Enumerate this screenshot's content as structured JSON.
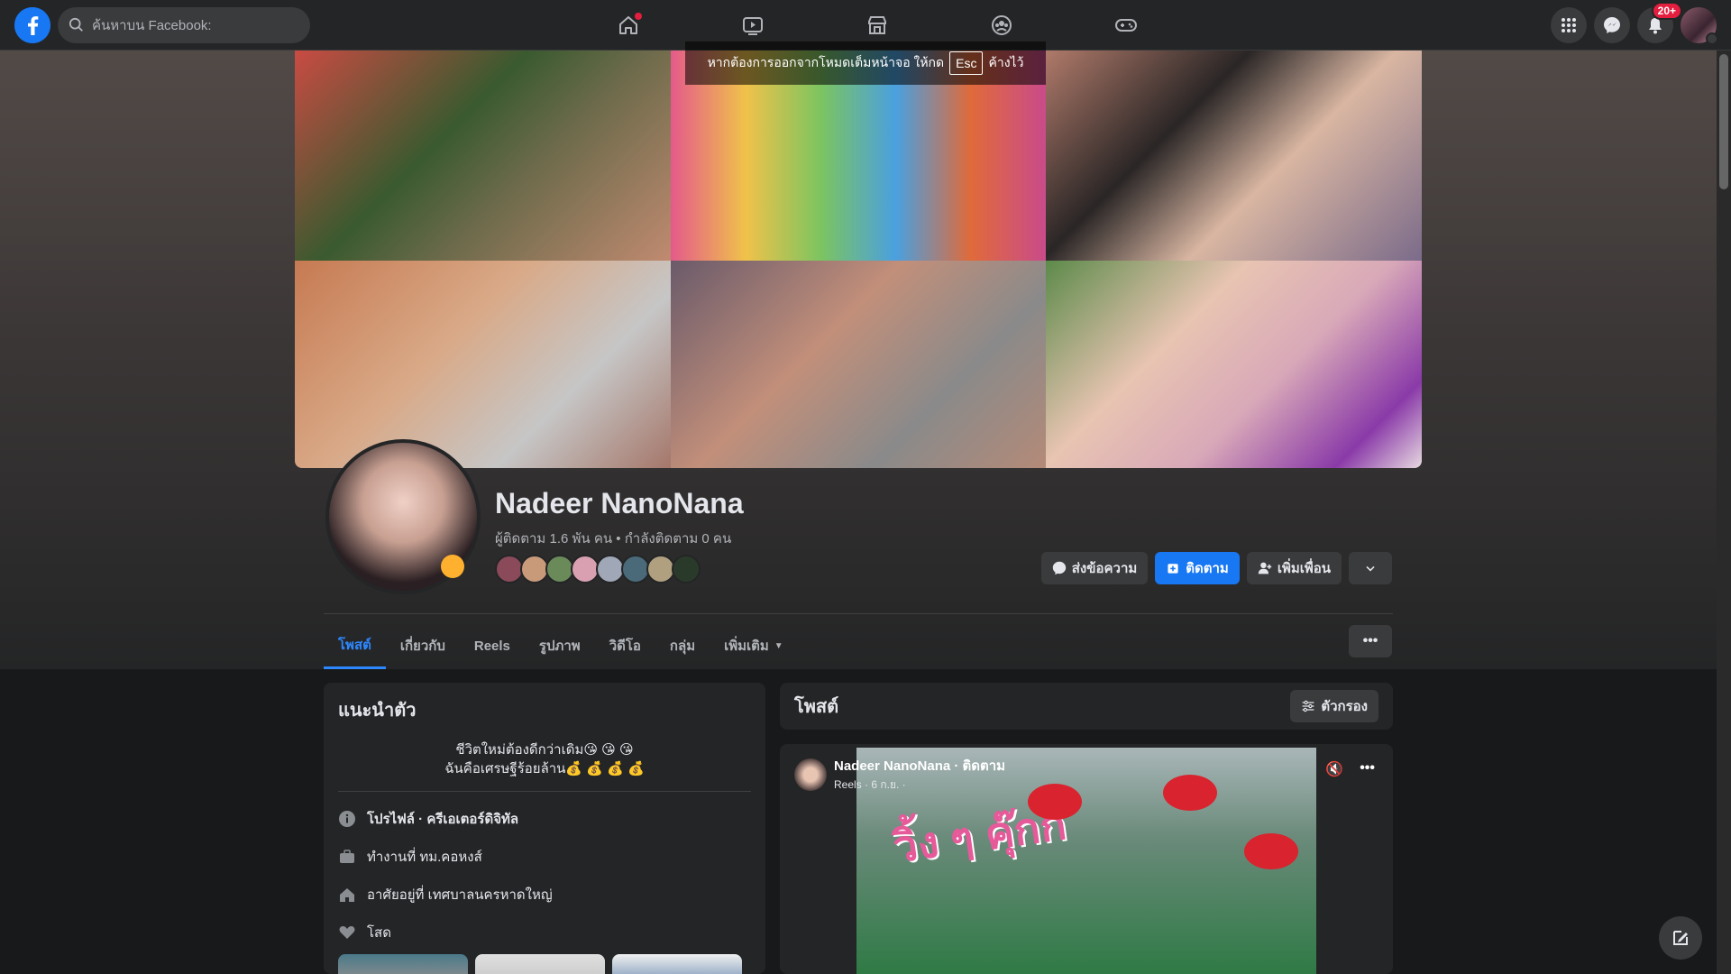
{
  "search": {
    "placeholder": "ค้นหาบน Facebook:"
  },
  "nav": {
    "tabs": [
      "home-icon",
      "watch-icon",
      "marketplace-icon",
      "groups-icon",
      "gaming-icon"
    ],
    "home_has_dot": true
  },
  "header_right": {
    "notifications_badge": "20+"
  },
  "fullscreen_toast": {
    "before": "หากต้องการออกจากโหมดเต็มหน้าจอ ให้กด",
    "key": "Esc",
    "after": "ค้างไว้"
  },
  "profile": {
    "name": "Nadeer NanoNana",
    "stats": "ผู้ติดตาม 1.6 พัน คน • กำลังติดตาม 0 คน",
    "friend_avatars": 8
  },
  "actions": {
    "message": "ส่งข้อความ",
    "follow": "ติดตาม",
    "add_friend": "เพิ่มเพื่อน"
  },
  "tabs": [
    {
      "label": "โพสต์",
      "active": true
    },
    {
      "label": "เกี่ยวกับ"
    },
    {
      "label": "Reels"
    },
    {
      "label": "รูปภาพ"
    },
    {
      "label": "วิดีโอ"
    },
    {
      "label": "กลุ่ม"
    },
    {
      "label": "เพิ่มเติม"
    }
  ],
  "intro": {
    "title": "แนะนำตัว",
    "bio_line1": "ชีวิตใหม่ต้องดีกว่าเดิม😘 😘 😘",
    "bio_line2": "ฉันคือเศรษฐีร้อยล้าน💰 💰 💰 💰",
    "profile_type": "โปรไฟล์ · ครีเอเตอร์ดิจิทัล",
    "work": "ทำงานที่ ทม.คอหงส์",
    "lives": "อาศัยอยู่ที่ เทศบาลนครหาดใหญ่",
    "relationship": "โสด"
  },
  "posts": {
    "title": "โพสต์",
    "filter": "ตัวกรอง",
    "post": {
      "author": "Nadeer NanoNana · ติดตาม",
      "meta": "Reels · 6 ก.ย. ·",
      "reel_text": "วิ้ง ๆ คุ๊กกี้"
    }
  },
  "colors": {
    "accent": "#2d88ff",
    "primary_button": "#1877f2",
    "badge": "#e41e3f",
    "background": "#18191a",
    "surface": "#242526"
  }
}
